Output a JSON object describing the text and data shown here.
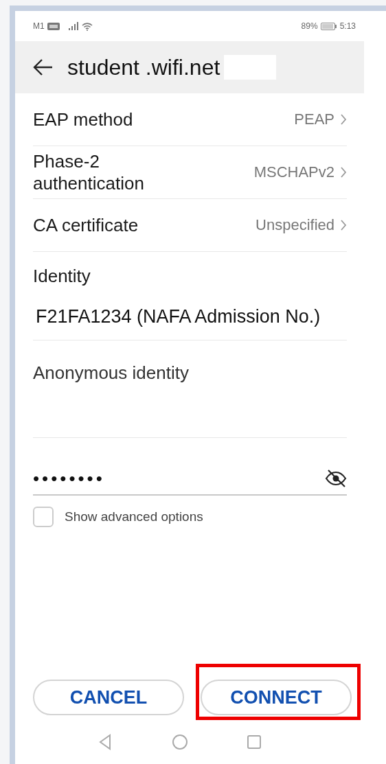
{
  "status_bar": {
    "carrier": "M1",
    "battery": "89%",
    "time": "5:13"
  },
  "title": "student .wifi.net",
  "settings": [
    {
      "label": "EAP method",
      "value": "PEAP"
    },
    {
      "label": "Phase-2 authentication",
      "value": "MSCHAPv2"
    },
    {
      "label": "CA certificate",
      "value": "Unspecified"
    }
  ],
  "identity": {
    "label": "Identity",
    "value": "F21FA1234 (NAFA Admission No.)"
  },
  "anonymous_identity": {
    "label": "Anonymous identity"
  },
  "password": {
    "value": "••••••••",
    "visible": false
  },
  "show_advanced": {
    "label": "Show advanced options",
    "checked": false
  },
  "buttons": [
    {
      "label": "CANCEL",
      "highlighted": false
    },
    {
      "label": "CONNECT",
      "highlighted": true
    }
  ]
}
